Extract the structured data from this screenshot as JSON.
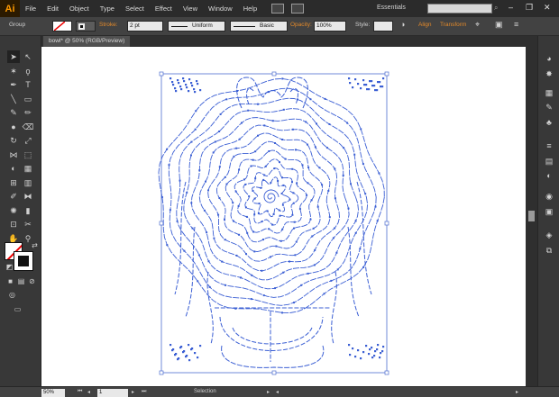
{
  "app": {
    "logo": "Ai"
  },
  "menu": [
    "File",
    "Edit",
    "Object",
    "Type",
    "Select",
    "Effect",
    "View",
    "Window",
    "Help"
  ],
  "workspace": "Essentials",
  "window_buttons": [
    "–",
    "❐",
    "✕"
  ],
  "control": {
    "selection_label": "Group",
    "stroke_label": "Stroke:",
    "stroke_value": "2 pt",
    "profile_value": "Uniform",
    "brush_value": "Basic",
    "opacity_label": "Opacity:",
    "opacity_value": "100%",
    "style_label": "Style:",
    "align_label": "Align",
    "transform_label": "Transform"
  },
  "document": {
    "tab_title": "bowl* @ 50% (RGB/Preview)"
  },
  "status": {
    "zoom": "50%",
    "page": "1",
    "tool": "Selection"
  },
  "colors": {
    "selection_blue": "#4f6ed1",
    "anchor_blue": "#3b5fd4",
    "canvas": "#ffffff",
    "accent_orange": "#e48a2a"
  },
  "tools": [
    "selection-tool",
    "direct-selection-tool",
    "magic-wand-tool",
    "lasso-tool",
    "pen-tool",
    "type-tool",
    "line-tool",
    "rectangle-tool",
    "paintbrush-tool",
    "pencil-tool",
    "blob-brush-tool",
    "eraser-tool",
    "rotate-tool",
    "scale-tool",
    "width-tool",
    "free-transform-tool",
    "shape-builder-tool",
    "perspective-grid-tool",
    "mesh-tool",
    "gradient-tool",
    "eyedropper-tool",
    "blend-tool",
    "symbol-sprayer-tool",
    "column-graph-tool",
    "artboard-tool",
    "slice-tool",
    "hand-tool",
    "zoom-tool"
  ]
}
